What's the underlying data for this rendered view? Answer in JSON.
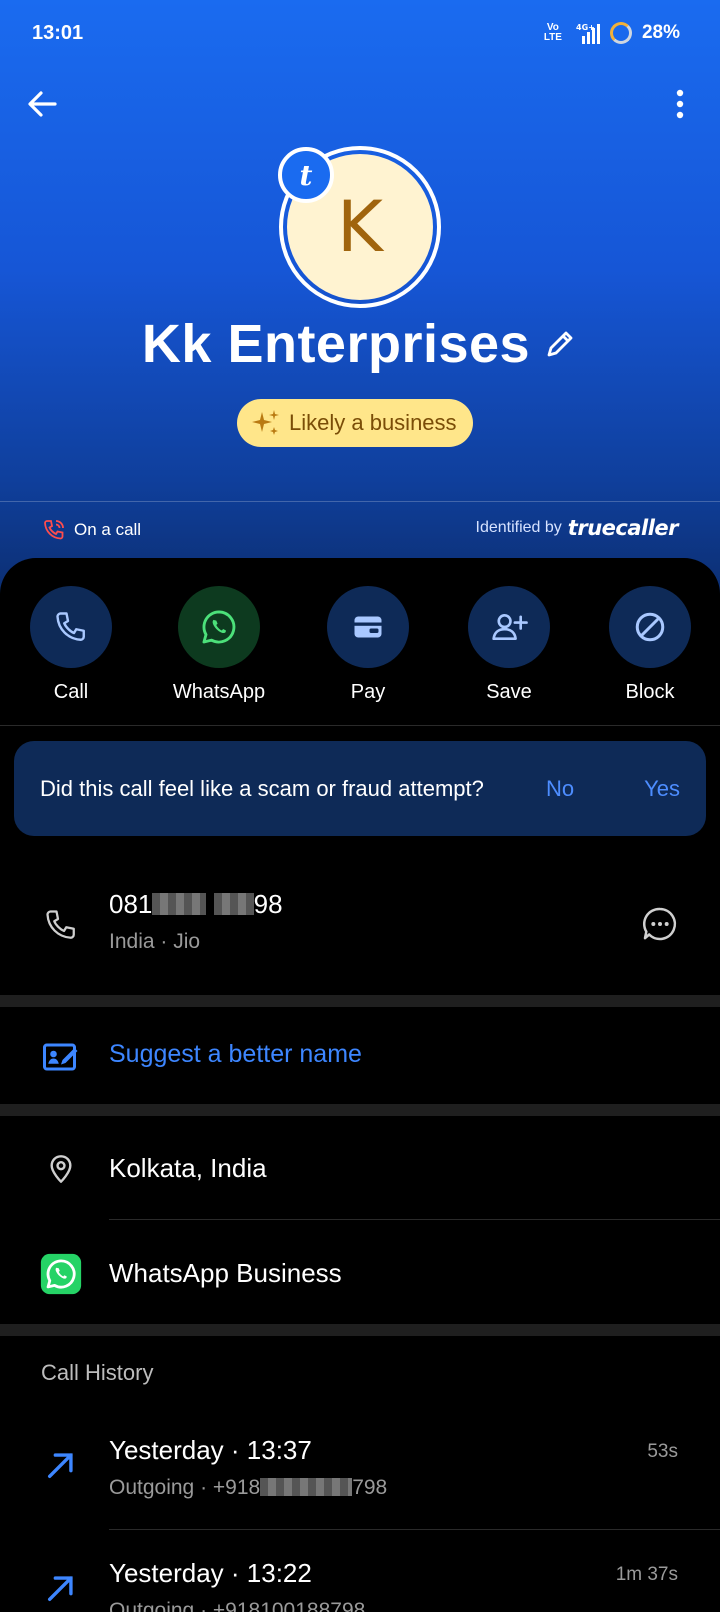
{
  "status_bar": {
    "time": "13:01",
    "volte": "Vo LTE",
    "network": "4G+",
    "battery": "28%"
  },
  "contact": {
    "initial": "K",
    "badge_letter": "t",
    "name": "Kk Enterprises",
    "business_chip": "Likely a business",
    "call_status": "On a call",
    "identified_by": "Identified by",
    "truecaller_logo": "truecaller"
  },
  "actions": [
    {
      "label": "Call",
      "icon": "phone-icon"
    },
    {
      "label": "WhatsApp",
      "icon": "whatsapp-icon"
    },
    {
      "label": "Pay",
      "icon": "wallet-icon"
    },
    {
      "label": "Save",
      "icon": "add-contact-icon"
    },
    {
      "label": "Block",
      "icon": "block-icon"
    }
  ],
  "scam_prompt": {
    "question": "Did this call feel like a scam or fraud attempt?",
    "no": "No",
    "yes": "Yes"
  },
  "number": {
    "prefix": "081",
    "suffix": "98",
    "sub": "India · Jio"
  },
  "suggest_label": "Suggest a better name",
  "location": "Kolkata, India",
  "whatsapp_business": "WhatsApp Business",
  "call_history": {
    "title": "Call History",
    "entries": [
      {
        "when": "Yesterday · 13:37",
        "type": "Outgoing · +918",
        "number_tail": "798",
        "duration": "53s"
      },
      {
        "when": "Yesterday · 13:22",
        "type": "Outgoing · +918100188798",
        "duration": "1m 37s"
      }
    ]
  },
  "colors": {
    "header_blue": "#1a6bf0",
    "accent_blue": "#3d86ff",
    "chip_yellow": "#ffe68a",
    "whatsapp_green": "#25d366"
  }
}
